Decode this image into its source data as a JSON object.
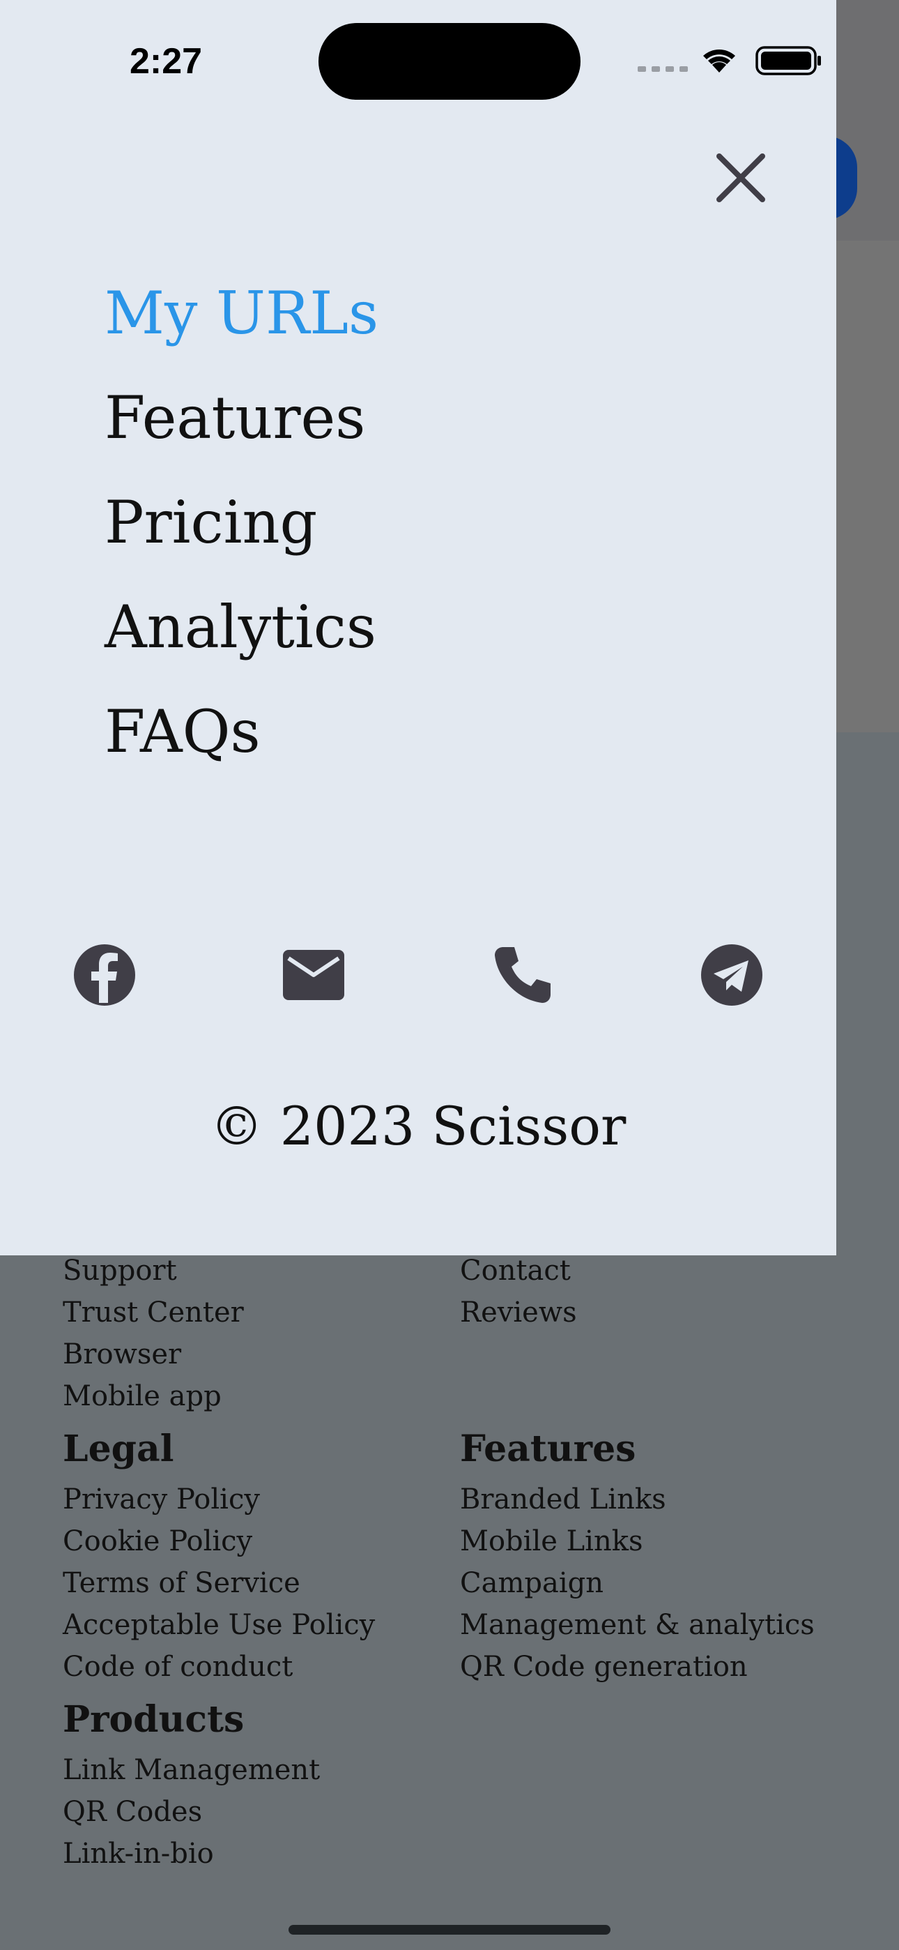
{
  "status_bar": {
    "time": "2:27"
  },
  "menu": {
    "items": [
      {
        "label": "My URLs",
        "active": true
      },
      {
        "label": "Features",
        "active": false
      },
      {
        "label": "Pricing",
        "active": false
      },
      {
        "label": "Analytics",
        "active": false
      },
      {
        "label": "FAQs",
        "active": false
      }
    ],
    "social_icons": [
      "facebook-icon",
      "mail-icon",
      "phone-icon",
      "telegram-icon"
    ],
    "copyright": "© 2023 Scissor",
    "accent_color": "#2a95e8"
  },
  "footer": {
    "col1_links_top": [
      "Support",
      "Trust Center",
      "Browser",
      "Mobile app"
    ],
    "col2_links_top": [
      "Contact",
      "Reviews"
    ],
    "legal": {
      "heading": "Legal",
      "links": [
        "Privacy Policy",
        "Cookie Policy",
        "Terms of Service",
        "Acceptable Use Policy",
        "Code of conduct"
      ]
    },
    "features": {
      "heading": "Features",
      "links": [
        "Branded Links",
        "Mobile Links",
        "Campaign",
        "Management & analytics",
        "QR Code generation"
      ]
    },
    "products": {
      "heading": "Products",
      "links": [
        "Link Management",
        "QR Codes",
        "Link-in-bio"
      ]
    }
  }
}
